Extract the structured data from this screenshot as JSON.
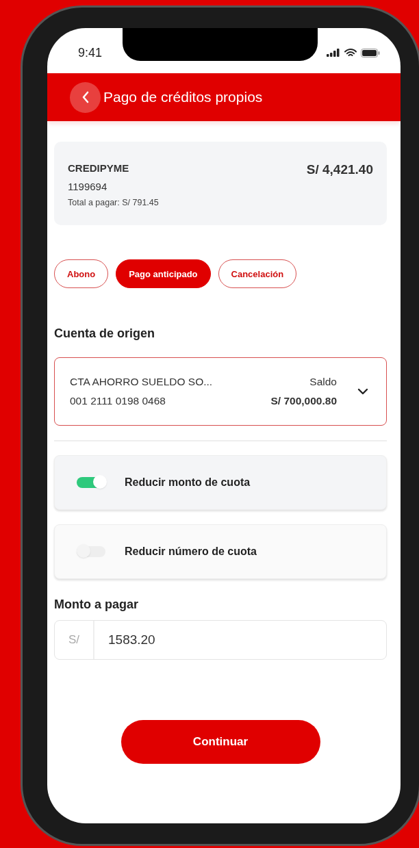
{
  "status_bar": {
    "time": "9:41"
  },
  "header": {
    "title": "Pago de créditos propios"
  },
  "credit": {
    "name": "CREDIPYME",
    "number": "1199694",
    "total": "Total a pagar: S/ 791.45",
    "amount": "S/ 4,421.40"
  },
  "payment_types": [
    {
      "label": "Abono",
      "selected": false
    },
    {
      "label": "Pago anticipado",
      "selected": true
    },
    {
      "label": "Cancelación",
      "selected": false
    }
  ],
  "source_account": {
    "label": "Cuenta de origen",
    "name": "CTA AHORRO SUELDO SO...",
    "number": "001 2111 0198 0468",
    "balance_label": "Saldo",
    "balance": "S/ 700,000.80"
  },
  "options": [
    {
      "label": "Reducir monto de cuota",
      "on": true
    },
    {
      "label": "Reducir número de cuota",
      "on": false
    }
  ],
  "amount": {
    "label": "Monto a pagar",
    "currency": "S/",
    "value": "1583.20"
  },
  "continue_button": "Continuar"
}
